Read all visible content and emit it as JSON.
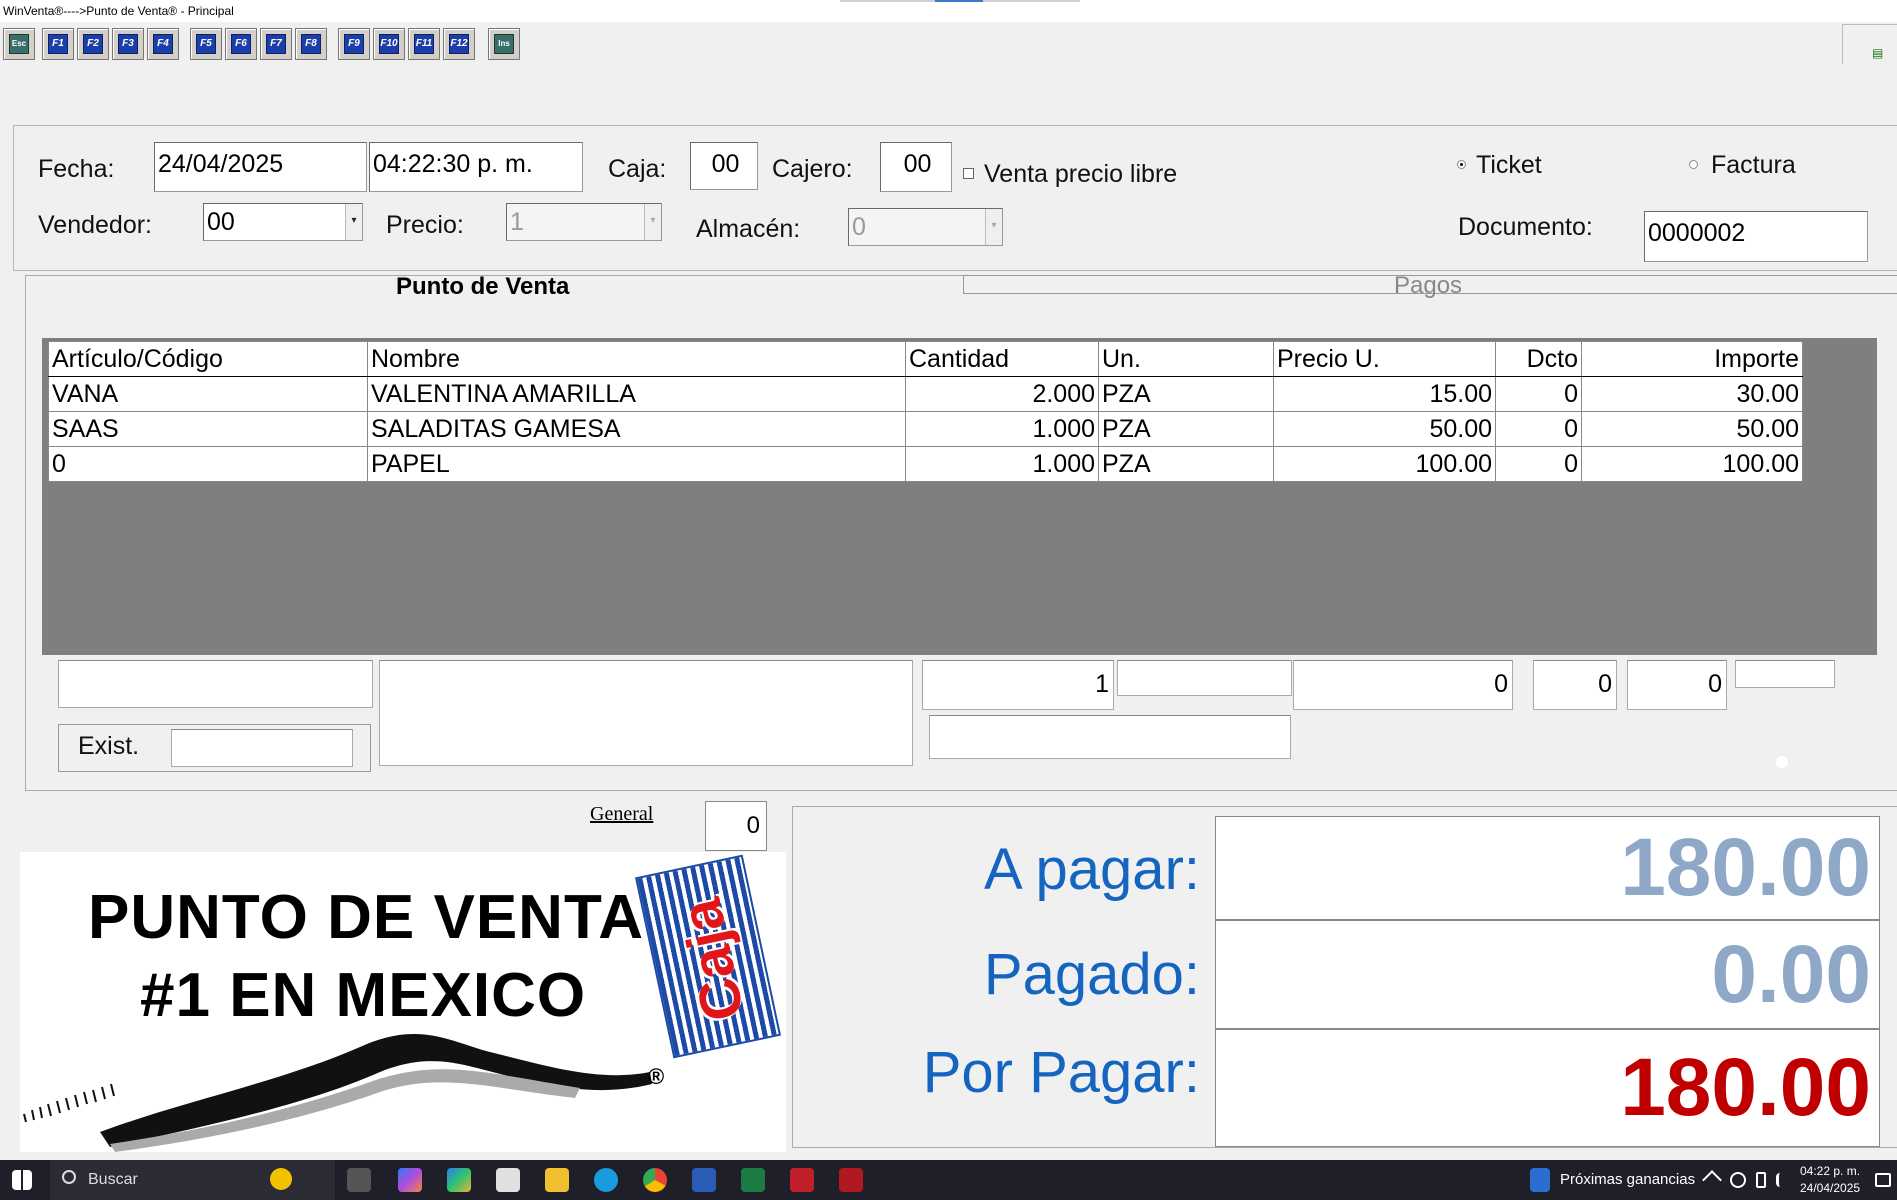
{
  "window": {
    "title": "WinVenta®---->Punto de Venta® - Principal"
  },
  "toolbar": {
    "buttons": [
      "Esc",
      "F1",
      "F2",
      "F3",
      "F4",
      "F5",
      "F6",
      "F7",
      "F8",
      "F9",
      "F10",
      "F11",
      "F12",
      "Ins"
    ]
  },
  "header": {
    "fecha_label": "Fecha:",
    "fecha": "24/04/2025",
    "hora": "04:22:30 p. m.",
    "caja_label": "Caja:",
    "caja": "00",
    "cajero_label": "Cajero:",
    "cajero": "00",
    "venta_precio_libre_label": "Venta  precio libre",
    "ticket_label": "Ticket",
    "factura_label": "Factura",
    "vendedor_label": "Vendedor:",
    "vendedor": "00",
    "precio_label": "Precio:",
    "precio": "1",
    "almacen_label": "Almacén:",
    "almacen": "0",
    "documento_label": "Documento:",
    "documento": "0000002"
  },
  "tabs": [
    {
      "label": "Punto de Venta"
    },
    {
      "label": "Pagos"
    }
  ],
  "grid": {
    "columns": [
      "Artículo/Código",
      "Nombre",
      "Cantidad",
      "Un.",
      "Precio U.",
      "Dcto",
      "Importe"
    ],
    "rows": [
      [
        "VANA",
        "VALENTINA AMARILLA",
        "2.000",
        "PZA",
        "15.00",
        "0",
        "30.00"
      ],
      [
        "SAAS",
        "SALADITAS GAMESA",
        "1.000",
        "PZA",
        "50.00",
        "0",
        "50.00"
      ],
      [
        "0",
        "PAPEL",
        "1.000",
        "PZA",
        "100.00",
        "0",
        "100.00"
      ]
    ]
  },
  "entry": {
    "cantidad": "1",
    "precio": "0",
    "dcto": "0",
    "importe": "0",
    "exist_label": "Exist."
  },
  "general": {
    "label": "General",
    "value": "0"
  },
  "logo": {
    "line1": "PUNTO DE VENTA",
    "line2": "#1 EN MEXICO",
    "brand": "Caja",
    "registered": "®"
  },
  "totals": {
    "a_pagar_label": "A pagar:",
    "a_pagar": "180.00",
    "pagado_label": "Pagado:",
    "pagado": "0.00",
    "por_pagar_label": "Por Pagar:",
    "por_pagar": "180.00"
  },
  "colors": {
    "label_blue": "#1565c0",
    "a_pagar": "#8fa8c8",
    "por_pagar": "#c00000"
  },
  "taskbar": {
    "search_placeholder": "Buscar",
    "news": "Próximas ganancias",
    "time": "04:22 p. m.",
    "date": "24/04/2025"
  }
}
